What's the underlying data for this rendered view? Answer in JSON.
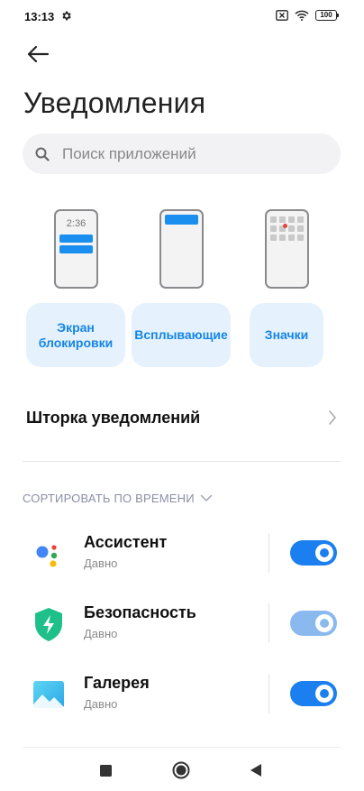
{
  "status": {
    "time": "13:13",
    "battery": "100"
  },
  "header": {
    "title": "Уведомления"
  },
  "search": {
    "placeholder": "Поиск приложений"
  },
  "styles": {
    "lockscreen_time": "2:36",
    "items": [
      {
        "label": "Экран блокировки"
      },
      {
        "label": "Всплывающие"
      },
      {
        "label": "Значки"
      }
    ]
  },
  "shade": {
    "label": "Шторка уведомлений"
  },
  "sort": {
    "label": "СОРТИРОВАТЬ ПО ВРЕМЕНИ"
  },
  "apps": [
    {
      "name": "Ассистент",
      "sub": "Давно",
      "enabled": true
    },
    {
      "name": "Безопасность",
      "sub": "Давно",
      "enabled": true
    },
    {
      "name": "Галерея",
      "sub": "Давно",
      "enabled": true
    }
  ],
  "colors": {
    "accent": "#1b7ff0",
    "card_bg": "#e5f2fd",
    "card_text": "#1485e6"
  }
}
